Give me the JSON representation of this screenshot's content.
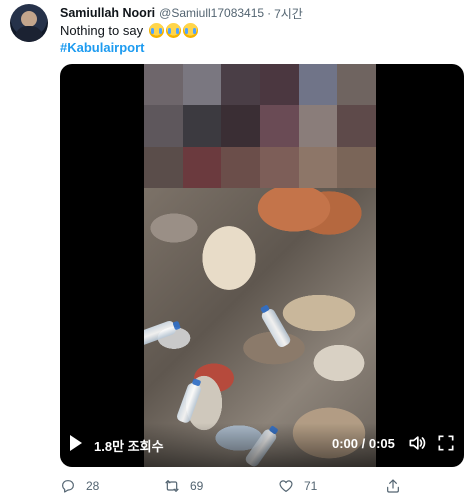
{
  "tweet": {
    "author_name": "Samiullah Noori",
    "author_handle": "@Samiull17083415",
    "separator": "·",
    "time": "7시간",
    "text": "Nothing to say",
    "emojis": [
      "loudly-crying-face-emoji",
      "loudly-crying-face-emoji",
      "loudly-crying-face-emoji"
    ],
    "hashtag": "#Kabulairport"
  },
  "video": {
    "views": "1.8만 조회수",
    "timecode": "0:00 / 0:05",
    "playing": false,
    "progress": 0
  },
  "actions": {
    "reply_count": "28",
    "retweet_count": "69",
    "like_count": "71",
    "icons": [
      "reply-icon",
      "retweet-icon",
      "like-icon",
      "share-icon"
    ]
  },
  "colors": {
    "link": "#1d9bf0",
    "muted": "#536471",
    "text": "#0f1419"
  }
}
